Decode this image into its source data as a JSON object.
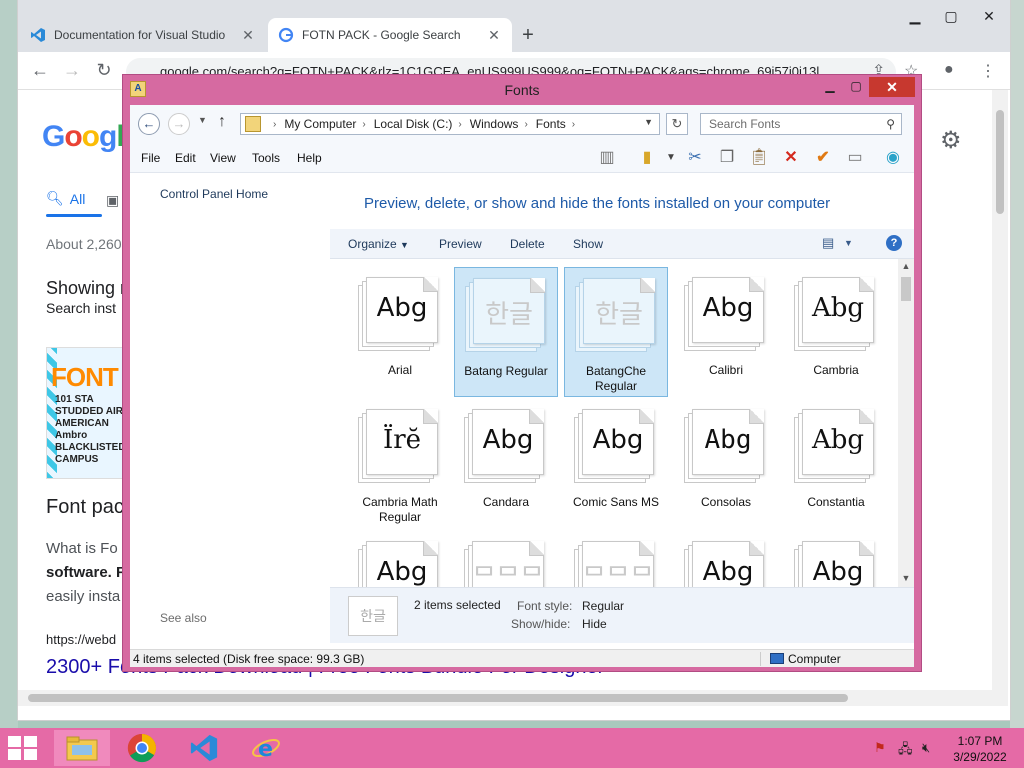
{
  "browser": {
    "tabs": [
      {
        "title": "Documentation for Visual Studio",
        "icon": "vscode-icon",
        "active": false
      },
      {
        "title": "FOTN PACK - Google Search",
        "icon": "google-icon",
        "active": true
      }
    ],
    "url": "google.com/search?q=FOTN+PACK&rlz=1C1GCEA_enUS999US999&oq=FOTN+PACK&aqs=chrome..69i57j0i13l"
  },
  "google": {
    "tab_all": "All",
    "about": "About 2,260",
    "showing": "Showing r",
    "search_instead": "Search inst",
    "result_title": "Font pac",
    "snippet_1": "What is Fo",
    "snippet_2": "software. F",
    "snippet_3": "easily insta",
    "result_url": "https://webd",
    "next_link": "2300+ Fonts Pack Download | Free Fonts Bundle For Designer",
    "thumb_text_1": "FONT",
    "thumb_text_2": "101 STA STUDDED AIR AMERICAN Ambro BLACKLISTED CAMPUS"
  },
  "explorer": {
    "title": "Fonts",
    "breadcrumb": [
      "My Computer",
      "Local Disk (C:)",
      "Windows",
      "Fonts"
    ],
    "search_placeholder": "Search Fonts",
    "menu": [
      "File",
      "Edit",
      "View",
      "Tools",
      "Help"
    ],
    "left_pane": {
      "control_panel_home": "Control Panel Home",
      "see_also": "See also"
    },
    "heading": "Preview, delete, or show and hide the fonts installed on your computer",
    "commands": {
      "organize": "Organize",
      "preview": "Preview",
      "delete": "Delete",
      "show": "Show"
    },
    "fonts": [
      {
        "name": "Arial",
        "sample": "Abg",
        "selected": false
      },
      {
        "name": "Batang Regular",
        "sample": "한글",
        "selected": true
      },
      {
        "name": "BatangChe Regular",
        "sample": "한글",
        "selected": true
      },
      {
        "name": "Calibri",
        "sample": "Abg",
        "selected": false
      },
      {
        "name": "Cambria",
        "sample": "Abg",
        "selected": false
      },
      {
        "name": "Cambria Math Regular",
        "sample": "Ïrĕ",
        "selected": false
      },
      {
        "name": "Candara",
        "sample": "Abg",
        "selected": false
      },
      {
        "name": "Comic Sans MS",
        "sample": "Abg",
        "selected": false
      },
      {
        "name": "Consolas",
        "sample": "Abg",
        "selected": false
      },
      {
        "name": "Constantia",
        "sample": "Abg",
        "selected": false
      },
      {
        "name": "",
        "sample": "Abg",
        "selected": false
      },
      {
        "name": "",
        "sample": "ᄆᄆᄆ",
        "selected": false
      },
      {
        "name": "",
        "sample": "ᄆᄆᄆ",
        "selected": false
      },
      {
        "name": "",
        "sample": "Abg",
        "selected": false
      },
      {
        "name": "",
        "sample": "Abg",
        "selected": false
      }
    ],
    "details": {
      "thumb": "한글",
      "count": "2 items selected",
      "font_style_label": "Font style:",
      "font_style_value": "Regular",
      "show_hide_label": "Show/hide:",
      "show_hide_value": "Hide"
    },
    "status": {
      "text": "4 items selected (Disk free space: 99.3 GB)",
      "location": "Computer"
    }
  },
  "taskbar": {
    "clock_time": "1:07 PM",
    "clock_date": "3/29/2022"
  },
  "colors": {
    "window_frame": "#d66aa1",
    "taskbar": "#e56aa6",
    "heading": "#1e5aa8",
    "selection": "#cde6f7"
  }
}
